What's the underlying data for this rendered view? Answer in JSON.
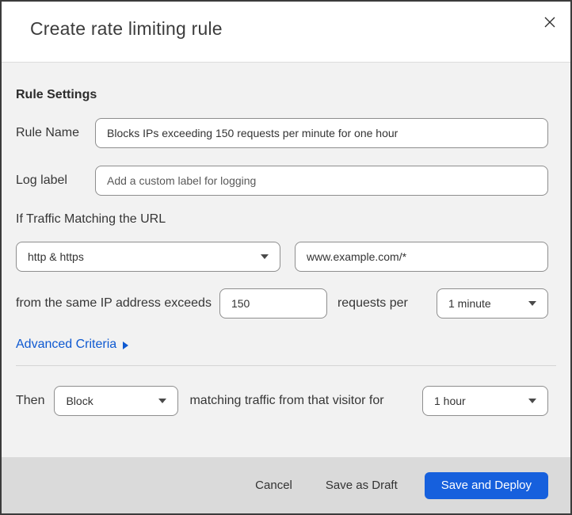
{
  "modal": {
    "title": "Create rate limiting rule"
  },
  "form": {
    "section_title": "Rule Settings",
    "rule_name": {
      "label": "Rule Name",
      "value": "Blocks IPs exceeding 150 requests per minute for one hour"
    },
    "log_label": {
      "label": "Log label",
      "placeholder": "Add a custom label for logging"
    },
    "traffic_match": {
      "label": "If Traffic Matching the URL",
      "scheme_selected": "http & https",
      "url_value": "www.example.com/*"
    },
    "threshold": {
      "prefix": "from the same IP address exceeds",
      "requests_value": "150",
      "middle": "requests per",
      "period_selected": "1 minute"
    },
    "advanced_criteria_label": "Advanced Criteria",
    "then": {
      "label": "Then",
      "action_selected": "Block",
      "middle": "matching traffic from that visitor for",
      "duration_selected": "1 hour"
    }
  },
  "footer": {
    "cancel_label": "Cancel",
    "save_draft_label": "Save as Draft",
    "save_deploy_label": "Save and Deploy"
  },
  "icons": {
    "close": "x-cross (two thin diagonal strokes)",
    "caret_down": "small solid down triangle",
    "arrow_right": "small solid right triangle"
  },
  "colors": {
    "accent_blue": "#1660dd",
    "link_blue": "#0e59d1",
    "body_bg": "#f2f2f2",
    "footer_bg": "#dadada",
    "border_dark": "#3b3b3b",
    "input_border": "#8e8e8e"
  }
}
